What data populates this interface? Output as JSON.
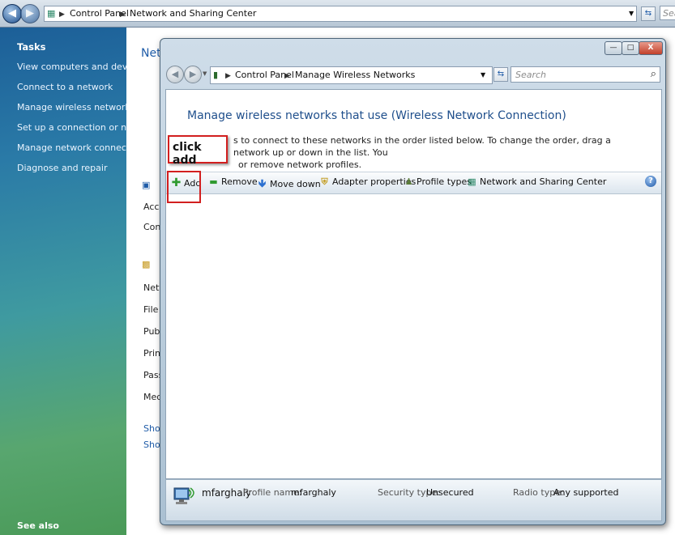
{
  "background_window": {
    "breadcrumb": [
      "Control Panel",
      "Network and Sharing Center"
    ],
    "search_placeholder": "Sea",
    "sidebar": {
      "header": "Tasks",
      "links": [
        "View computers and devices",
        "Connect to a network",
        "Manage wireless networks",
        "Set up a connection or network",
        "Manage network connections",
        "Diagnose and repair"
      ],
      "see_also": "See also"
    },
    "content": {
      "title": "Netw",
      "fragments": [
        "Acce",
        "Conr",
        "Netw",
        "File s",
        "Publi",
        "Print",
        "Passv",
        "Medi",
        "Show",
        "Show"
      ]
    }
  },
  "dialog": {
    "breadcrumb": [
      "Control Panel",
      "Manage Wireless Networks"
    ],
    "search_placeholder": "Search",
    "window_controls": {
      "minimize": "—",
      "maximize": "□",
      "close": "X"
    },
    "heading": "Manage wireless networks that use (Wireless Network Connection)",
    "description_line1": "s to connect to these networks in the order listed below. To change the order, drag a network up or down in the list. You",
    "description_line2": "or remove network profiles.",
    "toolbar": {
      "add": "Add",
      "remove": "Remove",
      "move_down": "Move down",
      "adapter_properties": "Adapter properties",
      "profile_types": "Profile types",
      "network_sharing_center": "Network and Sharing Center",
      "help": "?"
    },
    "status": {
      "network_name": "mfarghaly",
      "profile_label": "Profile name:",
      "profile_value": "mfarghaly",
      "security_label": "Security type:",
      "security_value": "Unsecured",
      "radio_label": "Radio type:",
      "radio_value": "Any supported"
    }
  },
  "annotation": {
    "callout_text": "click add",
    "highlight_color": "#d21f1f"
  },
  "icons": {
    "back": "back-arrow-icon",
    "forward": "forward-arrow-icon",
    "add": "plus-icon",
    "remove": "minus-icon",
    "move_down": "down-arrow-icon",
    "adapter": "shield-icon",
    "profile": "user-icon",
    "sharing": "network-icon",
    "search": "magnifier-icon"
  }
}
